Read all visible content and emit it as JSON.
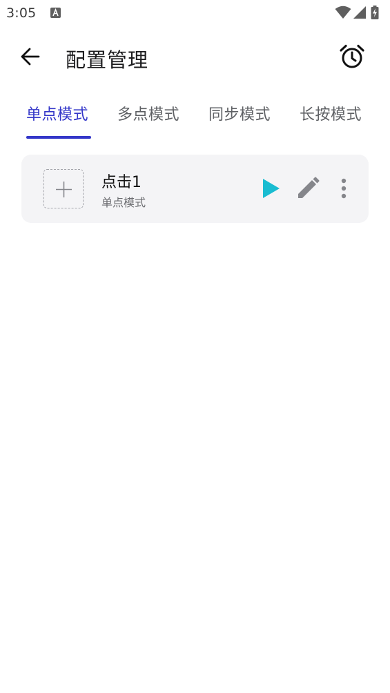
{
  "status_bar": {
    "time": "3:05",
    "icons": [
      "text-a-icon",
      "wifi-icon",
      "cell-signal-icon",
      "battery-charging-icon"
    ]
  },
  "app_bar": {
    "title": "配置管理",
    "back_icon": "arrow-back-icon",
    "alarm_icon": "alarm-clock-icon"
  },
  "tabs": [
    {
      "label": "单点模式",
      "active": true
    },
    {
      "label": "多点模式",
      "active": false
    },
    {
      "label": "同步模式",
      "active": false
    },
    {
      "label": "长按模式",
      "active": false
    }
  ],
  "configs": [
    {
      "title": "点击1",
      "subtitle": "单点模式",
      "thumb_icon": "add-icon",
      "actions": [
        "play-icon",
        "edit-icon",
        "more-vert-icon"
      ]
    }
  ],
  "colors": {
    "accent": "#3437c9",
    "play": "#19bcd1",
    "icon_gray": "#85868b",
    "card_bg": "#f4f4f6"
  }
}
